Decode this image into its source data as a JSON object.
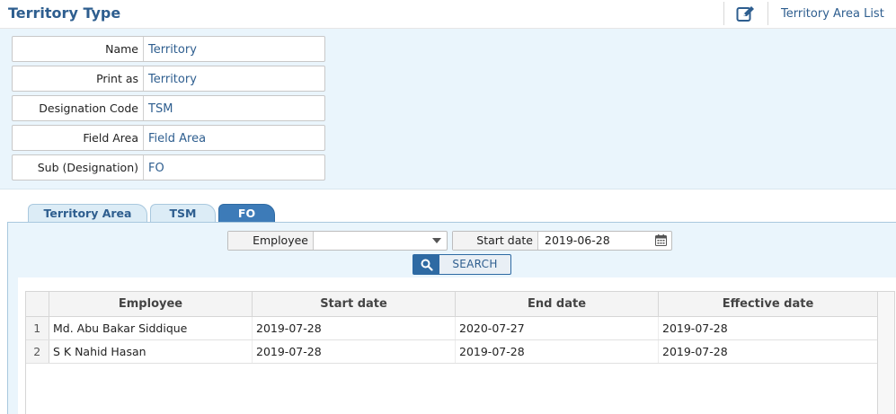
{
  "header": {
    "title": "Territory Type",
    "edit_icon": "edit-icon",
    "list_link": "Territory Area List"
  },
  "form": {
    "fields": [
      {
        "label": "Name",
        "value": "Territory"
      },
      {
        "label": "Print as",
        "value": "Territory"
      },
      {
        "label": "Designation Code",
        "value": "TSM"
      },
      {
        "label": "Field Area",
        "value": "Field Area"
      },
      {
        "label": "Sub (Designation)",
        "value": "FO"
      }
    ]
  },
  "tabs": [
    {
      "label": "Territory Area",
      "active": false
    },
    {
      "label": "TSM",
      "active": false
    },
    {
      "label": "FO",
      "active": true
    }
  ],
  "filters": {
    "employee_label": "Employee",
    "employee_value": "",
    "start_date_label": "Start date",
    "start_date_value": "2019-06-28",
    "search_label": "SEARCH"
  },
  "grid": {
    "columns": [
      "Employee",
      "Start date",
      "End date",
      "Effective date"
    ],
    "rows": [
      {
        "num": "1",
        "employee": "Md. Abu Bakar Siddique",
        "start": "2019-07-28",
        "end": "2020-07-27",
        "effective": "2019-07-28"
      },
      {
        "num": "2",
        "employee": "S K Nahid Hasan",
        "start": "2019-07-28",
        "end": "2019-07-28",
        "effective": "2019-07-28"
      }
    ]
  },
  "colors": {
    "accent": "#2e5e8f",
    "panel_bg": "#eaf5fc",
    "tab_active": "#3d7bb8"
  }
}
